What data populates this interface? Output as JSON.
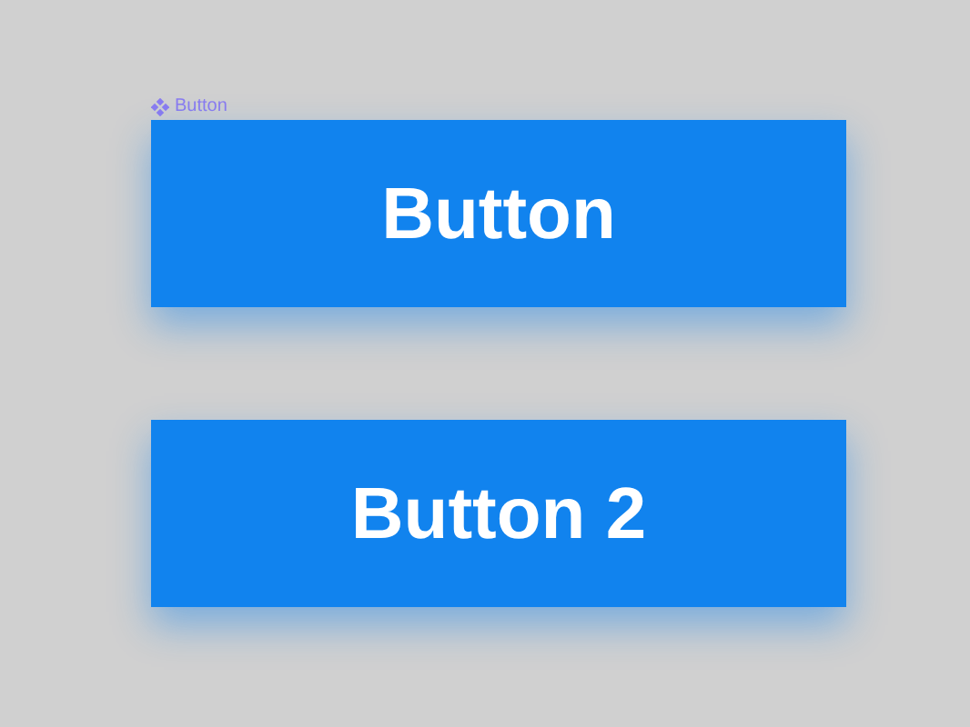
{
  "component_label": "Button",
  "buttons": [
    {
      "label": "Button"
    },
    {
      "label": "Button 2"
    }
  ]
}
